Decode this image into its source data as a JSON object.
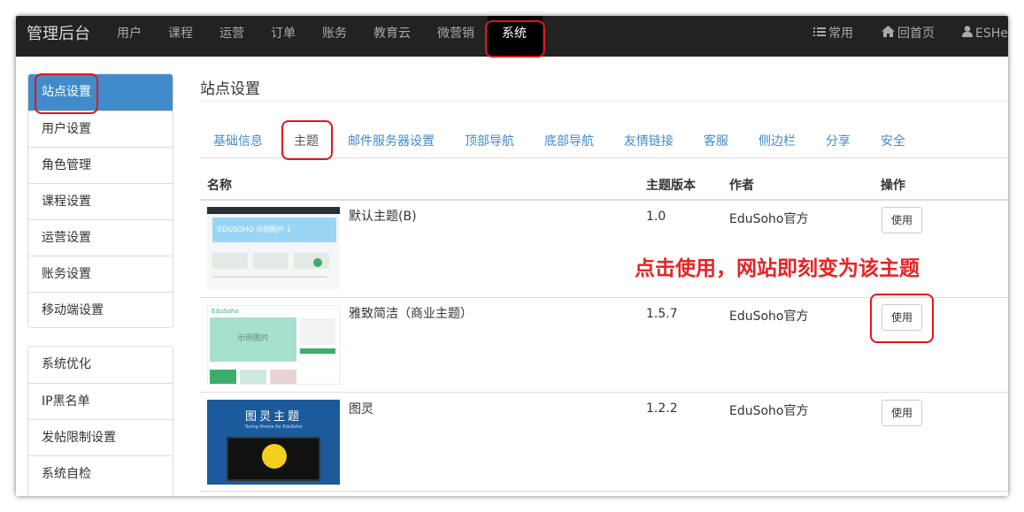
{
  "app": {
    "brand": "管理后台"
  },
  "nav": {
    "items": [
      "用户",
      "课程",
      "运营",
      "订单",
      "账务",
      "教育云",
      "微营销",
      "系统"
    ],
    "active": "系统",
    "right": {
      "common": "常用",
      "home": "回首页",
      "user": "ESHe"
    }
  },
  "sidebar": {
    "group1": [
      "站点设置",
      "用户设置",
      "角色管理",
      "课程设置",
      "运营设置",
      "账务设置",
      "移动端设置"
    ],
    "group2": [
      "系统优化",
      "IP黑名单",
      "发帖限制设置",
      "系统自检"
    ],
    "active": "站点设置"
  },
  "page": {
    "title": "站点设置"
  },
  "tabs": {
    "items": [
      "基础信息",
      "主题",
      "邮件服务器设置",
      "顶部导航",
      "底部导航",
      "友情链接",
      "客服",
      "侧边栏",
      "分享",
      "安全"
    ],
    "active": "主题"
  },
  "table": {
    "headers": {
      "name": "名称",
      "version": "主题版本",
      "author": "作者",
      "action": "操作"
    },
    "rows": [
      {
        "name": "默认主题(B)",
        "version": "1.0",
        "author": "EduSoho官方",
        "action": "使用",
        "thumb": {
          "banner": "EDUSOHO 示例图片 1"
        }
      },
      {
        "name": "雅致简洁（商业主题）",
        "version": "1.5.7",
        "author": "EduSoho官方",
        "action": "使用",
        "thumb": {
          "logo": "EduSoho",
          "banner": "示例图片"
        }
      },
      {
        "name": "图灵",
        "version": "1.2.2",
        "author": "EduSoho官方",
        "action": "使用",
        "thumb": {
          "banner": "图灵主题",
          "sub": "Turing theme for EduSoho"
        }
      }
    ]
  },
  "annotation": {
    "text": "点击使用，网站即刻变为该主题"
  },
  "colors": {
    "topbar": "#222222",
    "link": "#428bca",
    "highlight": "#e0161f",
    "annotation": "#e82323"
  }
}
